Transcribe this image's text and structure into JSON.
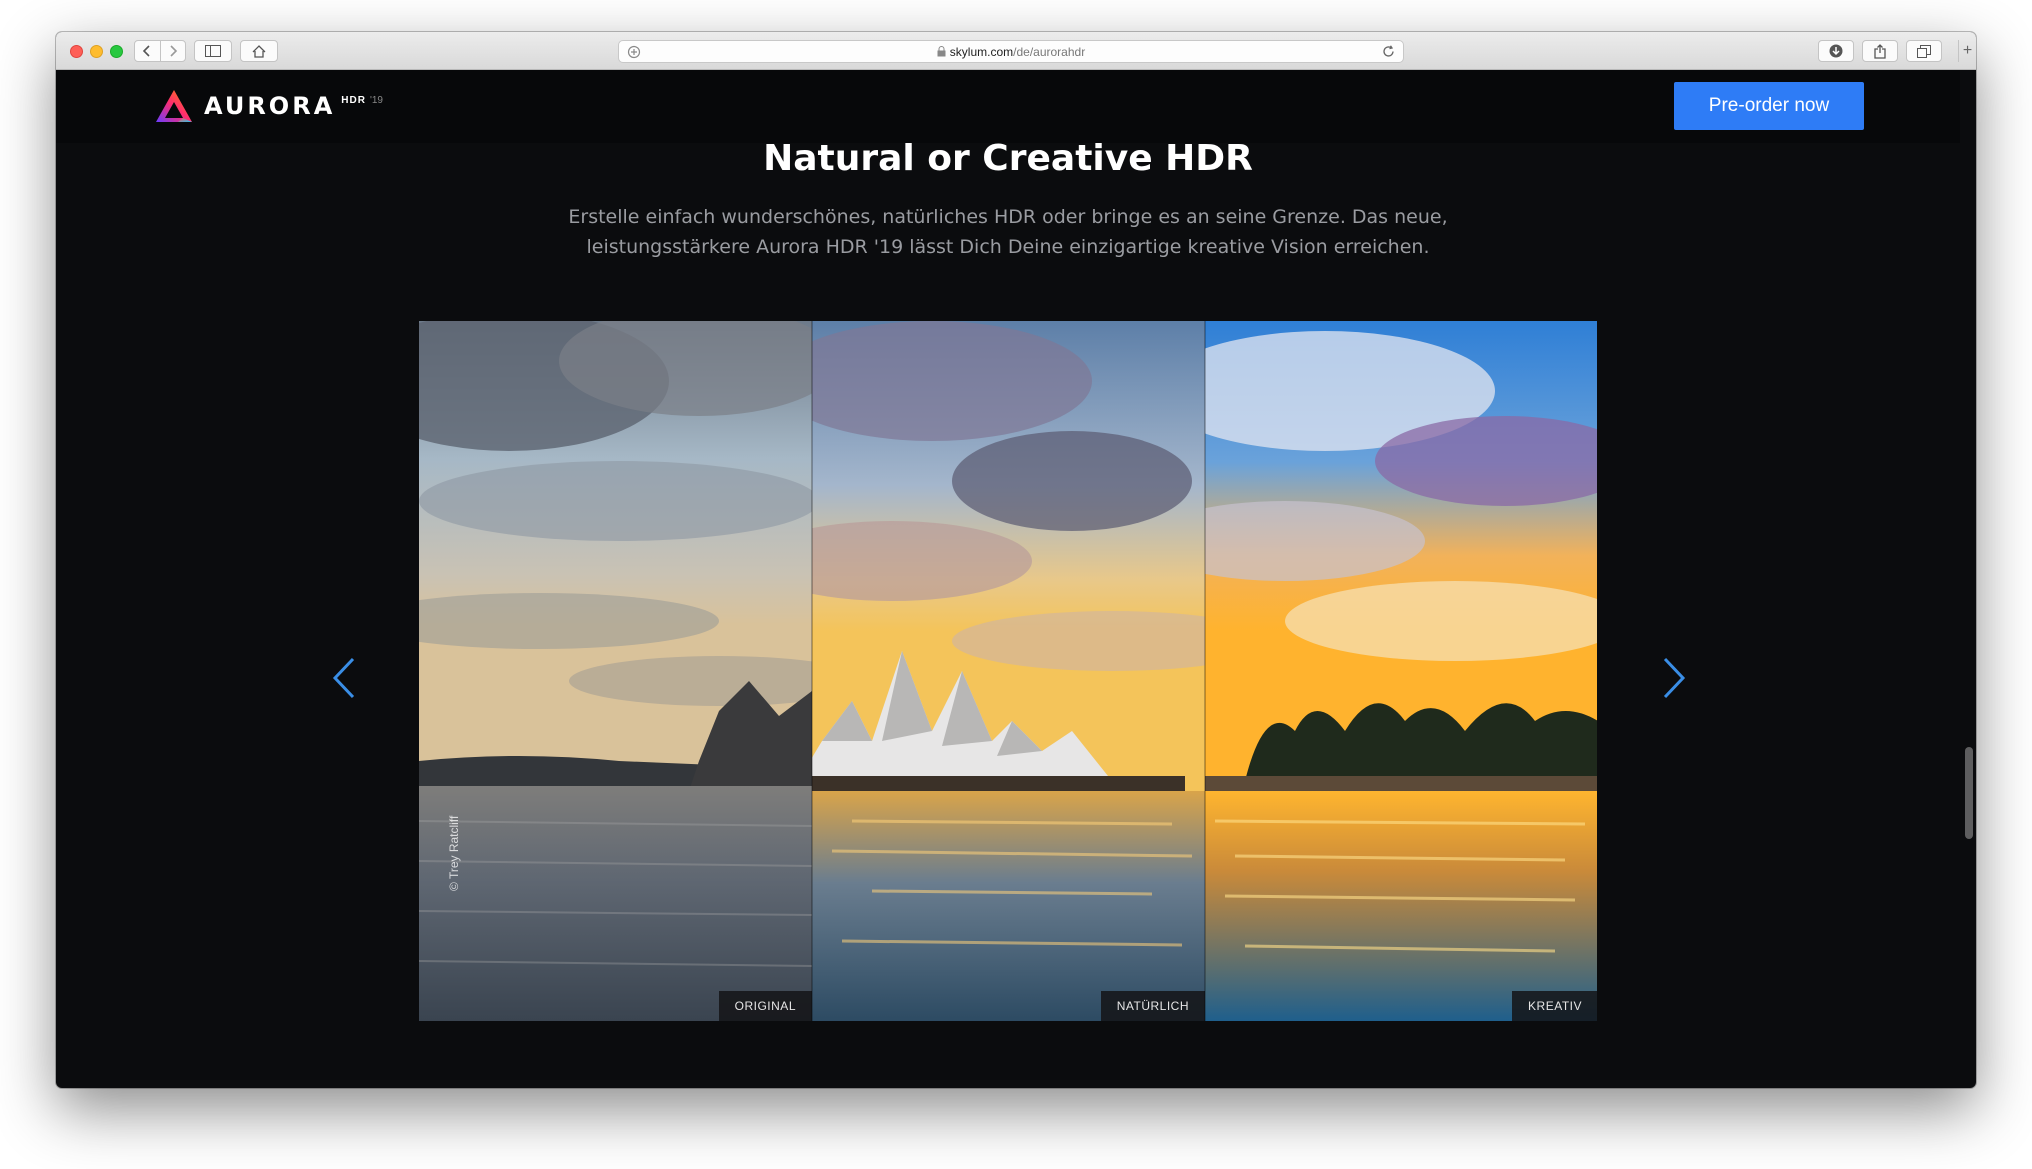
{
  "browser": {
    "url_domain": "skylum.com",
    "url_path": "/de/aurorahdr"
  },
  "header": {
    "logo_word": "AURORA",
    "logo_hdr": "HDR",
    "logo_year": "'19",
    "preorder_label": "Pre-order now"
  },
  "hero": {
    "title": "Natural or Creative HDR",
    "subtitle_line1": "Erstelle einfach wunderschönes, natürliches HDR oder bringe es an seine Grenze. Das neue,",
    "subtitle_line2": "leistungsstärkere Aurora HDR '19 lässt Dich Deine einzigartige kreative Vision erreichen."
  },
  "comparison": {
    "credit": "© Trey Ratcliff",
    "panels": [
      {
        "label": "ORIGINAL"
      },
      {
        "label": "NATÜRLICH"
      },
      {
        "label": "KREATIV"
      }
    ]
  },
  "colors": {
    "accent": "#2e7cf6",
    "page_bg": "#0b0c0e",
    "arrow": "#3a8ee6"
  },
  "icons": {
    "prev": "chevron-left-icon",
    "next": "chevron-right-icon"
  }
}
